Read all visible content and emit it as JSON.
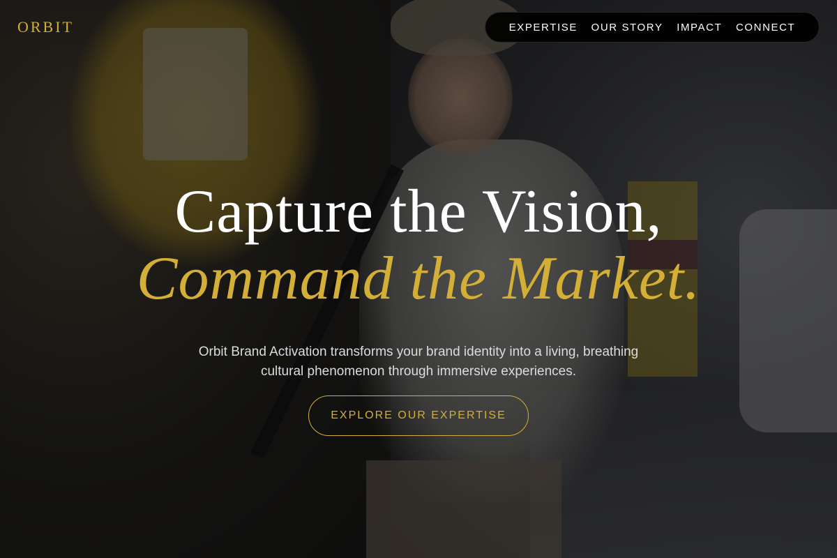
{
  "brand": {
    "logo_text": "ORBIT",
    "accent_color": "#d4af37"
  },
  "nav": {
    "items": [
      {
        "label": "EXPERTISE"
      },
      {
        "label": "OUR STORY"
      },
      {
        "label": "IMPACT"
      },
      {
        "label": "CONNECT"
      }
    ]
  },
  "hero": {
    "headline_line1": "Capture the Vision,",
    "headline_line2": "Command the Market.",
    "subcopy": "Orbit Brand Activation transforms your brand identity into a living, breathing cultural phenomenon through immersive experiences.",
    "cta_label": "EXPLORE OUR EXPERTISE"
  }
}
